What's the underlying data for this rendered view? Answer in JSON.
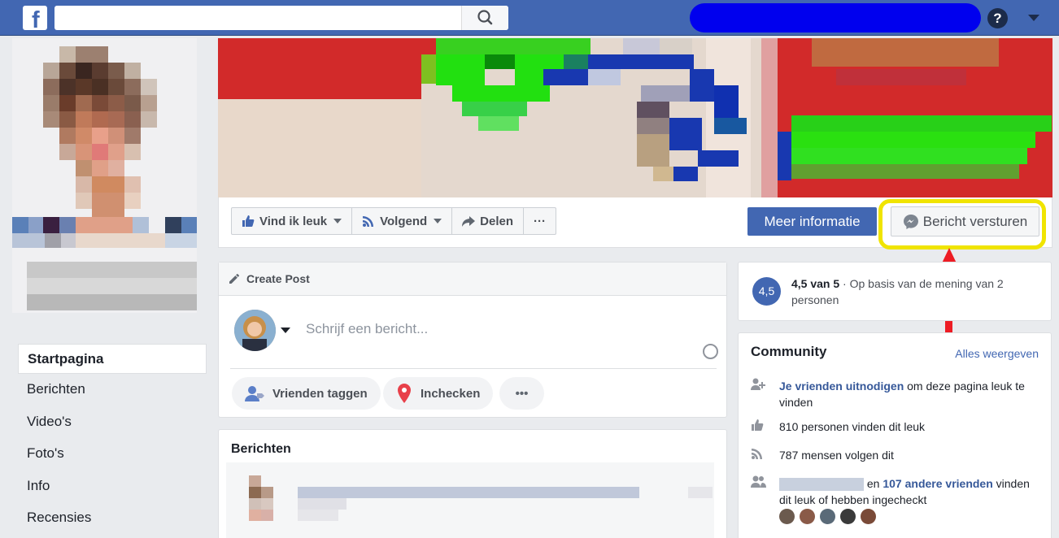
{
  "topbar": {
    "logo_letter": "f",
    "search_placeholder": "",
    "help_label": "?"
  },
  "left_nav": {
    "items": [
      {
        "label": "Startpagina",
        "active": true
      },
      {
        "label": "Berichten",
        "active": false
      },
      {
        "label": "Video's",
        "active": false
      },
      {
        "label": "Foto's",
        "active": false
      },
      {
        "label": "Info",
        "active": false
      },
      {
        "label": "Recensies",
        "active": false
      }
    ]
  },
  "page_actions": {
    "like_label": "Vind ik leuk",
    "follow_label": "Volgend",
    "share_label": "Delen",
    "more_label": "···",
    "more_info_label": "Meer informatie",
    "send_message_label": "Bericht versturen"
  },
  "create_post": {
    "title": "Create Post",
    "placeholder": "Schrijf een bericht...",
    "tag_friends_label": "Vrienden taggen",
    "check_in_label": "Inchecken",
    "more_label": "•••"
  },
  "posts": {
    "title": "Berichten"
  },
  "rating": {
    "badge": "4,5",
    "score": "4,5 van 5",
    "description": "· Op basis van de mening van 2 personen"
  },
  "community": {
    "title": "Community",
    "see_all": "Alles weergeven",
    "invite_link": "Je vrienden uitnodigen",
    "invite_rest": "om deze pagina leuk te vinden",
    "likes_text": "810 personen vinden dit leuk",
    "follows_text": "787 mensen volgen dit",
    "friends_prefix": "en",
    "friends_link": "107 andere vrienden",
    "friends_rest": "vinden dit leuk of hebben ingecheckt"
  },
  "colors": {
    "brand": "#4267b2",
    "highlight": "#f0e400",
    "annotation_arrow": "#ed1c24",
    "redaction": "#0000ee"
  }
}
